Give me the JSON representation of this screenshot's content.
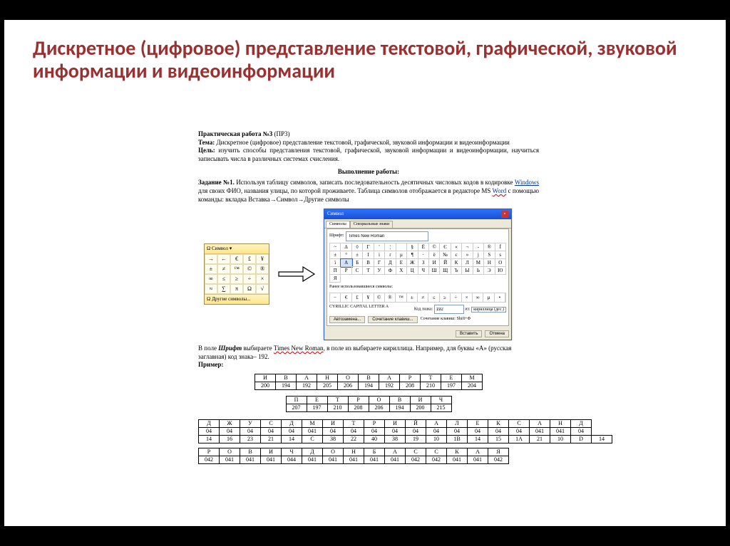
{
  "slide_title": "Дискретное (цифровое) представление текстовой, графической, звуковой информации и видеоинформации",
  "doc": {
    "h1_a": "Практическая работа №3",
    "h1_b": "(ПР3)",
    "tema_lbl": "Тема:",
    "tema": "Дискретное (цифровое) представление текстовой, графической, звуковой информации и видеоинформации",
    "cel_lbl": "Цель:",
    "cel": "изучить способы представления текстовой, графической, звуковой информации и видеоинформации, научиться записывать числа в различных системах счисления.",
    "work": "Выполнение работы:",
    "z1_lbl": "Задание №1.",
    "z1_a": "Используя таблицу символов, записать последовательность десятичных числовых кодов в кодировке ",
    "z1_win": "Windows",
    "z1_b": " для своих ФИО, названия улицы, по которой проживаете. Таблица символов отображается в редакторе MS ",
    "z1_word": "Word",
    "z1_c": " с помощью команды: вкладка Вставка→Символ→Другие символы",
    "p1_hdr": "Ω Символ ▾",
    "p1": [
      "→",
      "←",
      "€",
      "£",
      "¥",
      "±",
      "≠",
      "™",
      "©",
      "®",
      "∞",
      "≤",
      "≥",
      "÷",
      "×",
      "≈",
      "∑",
      "π",
      "Ω",
      "√"
    ],
    "p1_ftr": "Ω Другие символы...",
    "dlg_title": "Символ",
    "tab1": "Символы",
    "tab2": "Специальные знаки",
    "font_lbl": "Шрифт:",
    "font_val": "Times New Roman",
    "grid": [
      "~",
      "∆",
      "◊",
      "Γ",
      "'",
      "¦",
      " ",
      "§",
      "Ё",
      "©",
      "Є",
      "«",
      "¬",
      "-",
      "®",
      "Ї",
      "±",
      "°",
      "±",
      "І",
      "і",
      "ґ",
      "µ",
      "¶",
      "·",
      "ё",
      "№",
      "є",
      "»",
      "ј",
      "Ѕ",
      "ѕ",
      "ї",
      "А",
      "Б",
      "В",
      "Г",
      "Д",
      "Е",
      "Ж",
      "З",
      "И",
      "Й",
      "К",
      "Л",
      "М",
      "Н",
      "О",
      "П",
      "Р",
      "С",
      "Т",
      "У",
      "Ф",
      "Х",
      "Ц",
      "Ч",
      "Ш",
      "Щ",
      "Ъ",
      "Ы",
      "Ь",
      "Э",
      "Ю",
      "Я"
    ],
    "sel_index": 33,
    "recent_lbl": "Ранее использовавшиеся символы:",
    "recent": [
      "−",
      "€",
      "£",
      "¥",
      "©",
      "®",
      "™",
      "±",
      "≠",
      "≤",
      "≥",
      "÷",
      "×",
      "∞",
      "µ",
      "•"
    ],
    "char_name": "CYRILLIC CAPITAL LETTER A",
    "code_lbl": "Код знака:",
    "code_val": "192",
    "from_lbl": "из:",
    "from_val": "кириллица (дес.)",
    "btn_auto": "Автозамена...",
    "btn_short": "Сочетание клавиш...",
    "short_txt": "Сочетание клавиш: Shift+Ф",
    "btn_ins": "Вставить",
    "btn_cancel": "Отмена",
    "para2_a": "В поле ",
    "para2_shr": "Шрифт",
    "para2_b": " выбираете ",
    "para2_tnr": "Times New Roman",
    "para2_c": ", в поле из выбираете кириллица. Например, для буквы «А» (русская заглавная) код знака– 192.",
    "primer": "Пример:",
    "t1": {
      "h": [
        "И",
        "В",
        "А",
        "Н",
        "О",
        "В",
        "А",
        "Р",
        "Т",
        "Е",
        "М"
      ],
      "r": [
        "200",
        "194",
        "192",
        "205",
        "206",
        "194",
        "192",
        "208",
        "210",
        "197",
        "204"
      ]
    },
    "t2": {
      "h": [
        "П",
        "Е",
        "Т",
        "Р",
        "О",
        "В",
        "И",
        "Ч"
      ],
      "r": [
        "207",
        "197",
        "210",
        "208",
        "206",
        "194",
        "200",
        "215"
      ]
    },
    "t3": {
      "h": [
        "Д",
        "Ж",
        "У",
        "С",
        "Д",
        "М",
        "И",
        "Т",
        "Р",
        "И",
        "Й",
        "А",
        "Л",
        "Е",
        "К",
        "С",
        "А",
        "Н",
        "Д"
      ],
      "r1": [
        "04",
        "04",
        "04",
        "04",
        "04",
        "041",
        "04",
        "04",
        "04",
        "04",
        "04",
        "04",
        "04",
        "04",
        "04",
        "04",
        "041",
        "041",
        "04"
      ],
      "r2": [
        "14",
        "16",
        "23",
        "21",
        "14",
        "C",
        "38",
        "22",
        "40",
        "38",
        "19",
        "10",
        "1B",
        "14",
        "15",
        "1A",
        "21",
        "10",
        "D",
        "14"
      ]
    },
    "t4": {
      "h": [
        "Р",
        "О",
        "В",
        "И",
        "Ч",
        "Д",
        "О",
        "Н",
        "Б",
        "А",
        "С",
        "С",
        "К",
        "А",
        "Я"
      ],
      "r": [
        "042",
        "041",
        "041",
        "041",
        "044",
        "041",
        "041",
        "041",
        "041",
        "041",
        "042",
        "042",
        "041",
        "041",
        "042"
      ]
    }
  }
}
